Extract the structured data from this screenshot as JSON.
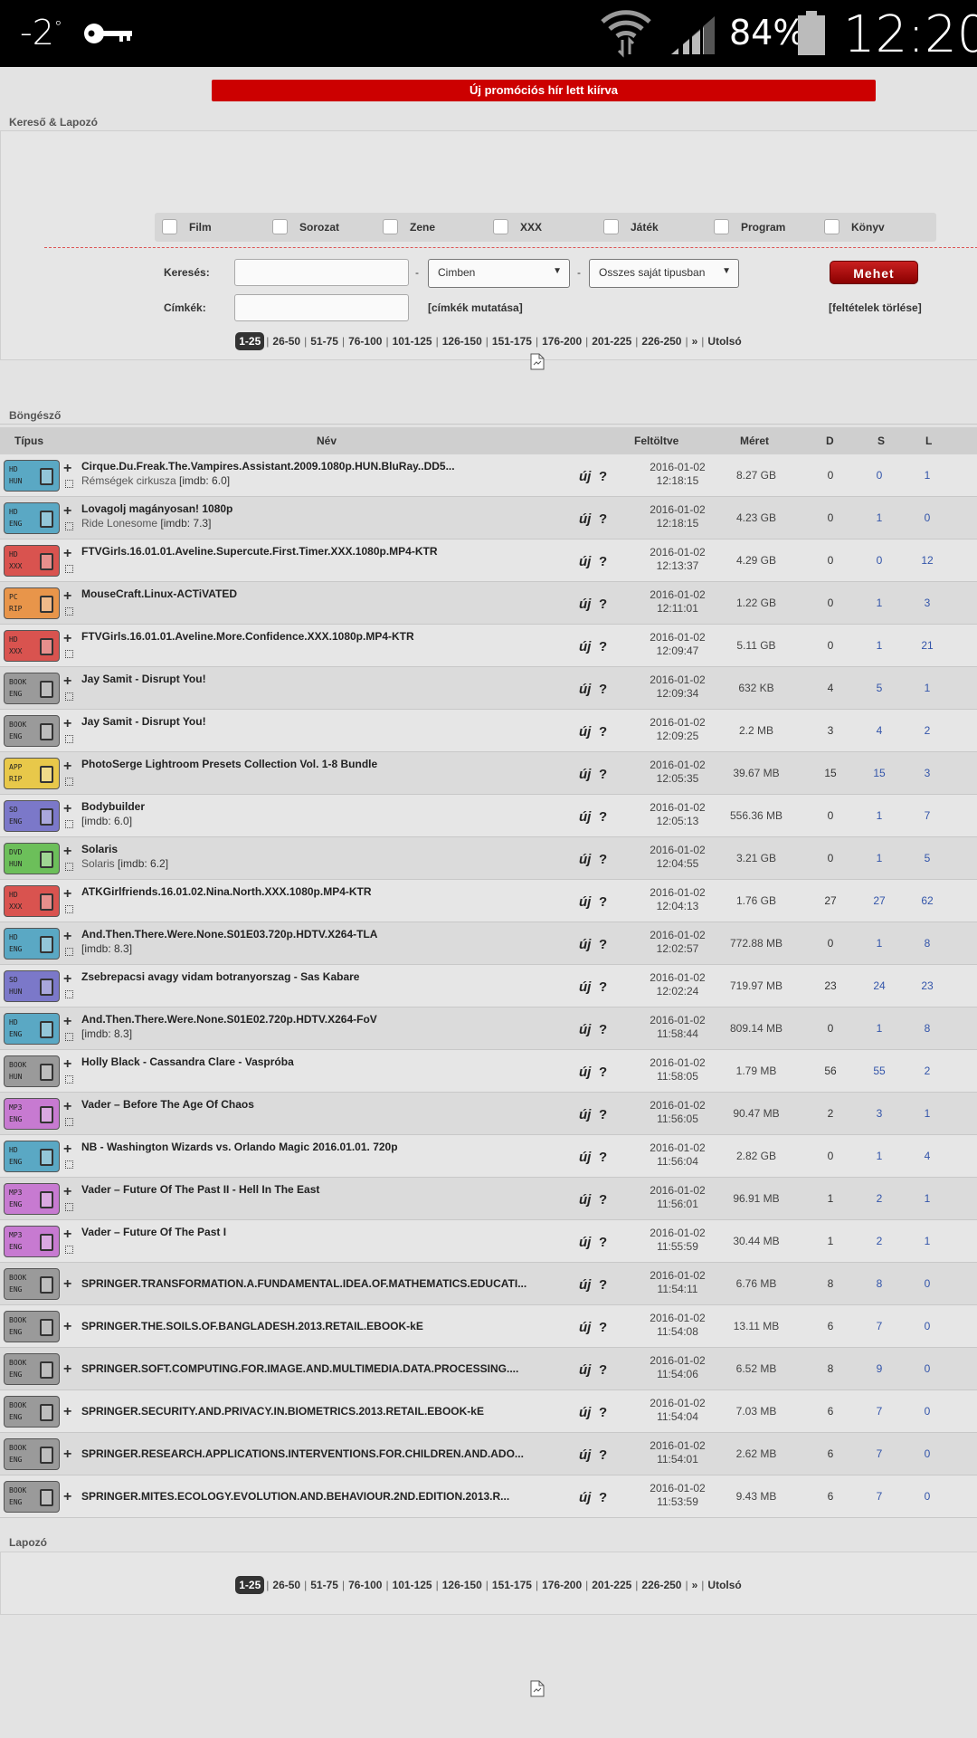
{
  "statusbar": {
    "temp": "-2",
    "deg": "°",
    "battery": "84%",
    "time": "12:20"
  },
  "promo": "Új promóciós hír lett kiírva",
  "search": {
    "title": "Kereső & Lapozó",
    "categories": [
      "Film",
      "Sorozat",
      "Zene",
      "XXX",
      "Játék",
      "Program",
      "Könyv"
    ],
    "search_label": "Keresés:",
    "tags_label": "Címkék:",
    "dash": "-",
    "scope_select": "Cimben",
    "type_select": "Osszes saját tipusban",
    "go": "Mehet",
    "show_tags": "[címkék mutatása]",
    "clear": "[feltételek törlése]"
  },
  "pager": {
    "pages": [
      "1-25",
      "26-50",
      "51-75",
      "76-100",
      "101-125",
      "126-150",
      "151-175",
      "176-200",
      "201-225",
      "226-250"
    ],
    "next": "»",
    "last": "Utolsó",
    "sep": "|"
  },
  "browser": {
    "title": "Böngésző",
    "bottom_title": "Lapozó"
  },
  "table": {
    "headers": {
      "type": "Típus",
      "name": "Név",
      "uploaded": "Feltöltve",
      "size": "Méret",
      "d": "D",
      "s": "S",
      "l": "L"
    },
    "new_label": "új",
    "q_label": "?",
    "rows": [
      {
        "badge": [
          "HD",
          "HUN"
        ],
        "color": "#5aa8c4",
        "icon": "film-icon",
        "name": "Cirque.Du.Freak.The.Vampires.Assistant.2009.1080p.HUN.BluRay..DD5...",
        "sub": "Rémségek cirkusza",
        "imdb": "[imdb: 6.0]",
        "date": "2016-01-02",
        "time": "12:18:15",
        "size": "8.27 GB",
        "d": "0",
        "s": "0",
        "l": "1"
      },
      {
        "badge": [
          "HD",
          "ENG"
        ],
        "color": "#5aa8c4",
        "icon": "film-icon",
        "name": "Lovagolj magányosan! 1080p",
        "sub": "Ride Lonesome",
        "imdb": "[imdb: 7.3]",
        "date": "2016-01-02",
        "time": "12:18:15",
        "size": "4.23 GB",
        "d": "0",
        "s": "1",
        "l": "0"
      },
      {
        "badge": [
          "HD",
          "XXX"
        ],
        "color": "#d9534f",
        "icon": "film-icon",
        "name": "FTVGirls.16.01.01.Aveline.Supercute.First.Timer.XXX.1080p.MP4-KTR",
        "sub": "",
        "imdb": "",
        "date": "2016-01-02",
        "time": "12:13:37",
        "size": "4.29 GB",
        "d": "0",
        "s": "0",
        "l": "12"
      },
      {
        "badge": [
          "PC",
          "RIP"
        ],
        "color": "#e8954a",
        "icon": "game-icon",
        "name": "MouseCraft.Linux-ACTiVATED",
        "sub": "",
        "imdb": "",
        "date": "2016-01-02",
        "time": "12:11:01",
        "size": "1.22 GB",
        "d": "0",
        "s": "1",
        "l": "3"
      },
      {
        "badge": [
          "HD",
          "XXX"
        ],
        "color": "#d9534f",
        "icon": "film-icon",
        "name": "FTVGirls.16.01.01.Aveline.More.Confidence.XXX.1080p.MP4-KTR",
        "sub": "",
        "imdb": "",
        "date": "2016-01-02",
        "time": "12:09:47",
        "size": "5.11 GB",
        "d": "0",
        "s": "1",
        "l": "21"
      },
      {
        "badge": [
          "BOOK",
          "ENG"
        ],
        "color": "#9a9a9a",
        "icon": "book-icon",
        "name": "Jay Samit - Disrupt You!",
        "sub": "",
        "imdb": "",
        "date": "2016-01-02",
        "time": "12:09:34",
        "size": "632 KB",
        "d": "4",
        "s": "5",
        "l": "1"
      },
      {
        "badge": [
          "BOOK",
          "ENG"
        ],
        "color": "#9a9a9a",
        "icon": "book-icon",
        "name": "Jay Samit - Disrupt You!",
        "sub": "",
        "imdb": "",
        "date": "2016-01-02",
        "time": "12:09:25",
        "size": "2.2 MB",
        "d": "3",
        "s": "4",
        "l": "2"
      },
      {
        "badge": [
          "APP",
          "RIP"
        ],
        "color": "#e8c84a",
        "icon": "app-icon",
        "name": "PhotoSerge Lightroom Presets Collection Vol. 1-8 Bundle",
        "sub": "",
        "imdb": "",
        "date": "2016-01-02",
        "time": "12:05:35",
        "size": "39.67 MB",
        "d": "15",
        "s": "15",
        "l": "3"
      },
      {
        "badge": [
          "SD",
          "ENG"
        ],
        "color": "#7b78c9",
        "icon": "film-icon",
        "name": "Bodybuilder",
        "sub": "",
        "imdb": "[imdb: 6.0]",
        "date": "2016-01-02",
        "time": "12:05:13",
        "size": "556.36 MB",
        "d": "0",
        "s": "1",
        "l": "7"
      },
      {
        "badge": [
          "DVD",
          "HUN"
        ],
        "color": "#6cbf5a",
        "icon": "film-icon",
        "name": "Solaris",
        "sub": "Solaris",
        "imdb": "[imdb: 6.2]",
        "date": "2016-01-02",
        "time": "12:04:55",
        "size": "3.21 GB",
        "d": "0",
        "s": "1",
        "l": "5"
      },
      {
        "badge": [
          "HD",
          "XXX"
        ],
        "color": "#d9534f",
        "icon": "film-icon",
        "name": "ATKGirlfriends.16.01.02.Nina.North.XXX.1080p.MP4-KTR",
        "sub": "",
        "imdb": "",
        "date": "2016-01-02",
        "time": "12:04:13",
        "size": "1.76 GB",
        "d": "27",
        "s": "27",
        "l": "62"
      },
      {
        "badge": [
          "HD",
          "ENG"
        ],
        "color": "#5aa8c4",
        "icon": "tv-icon",
        "name": "And.Then.There.Were.None.S01E03.720p.HDTV.X264-TLA",
        "sub": "",
        "imdb": "[imdb: 8.3]",
        "date": "2016-01-02",
        "time": "12:02:57",
        "size": "772.88 MB",
        "d": "0",
        "s": "1",
        "l": "8"
      },
      {
        "badge": [
          "SD",
          "HUN"
        ],
        "color": "#7b78c9",
        "icon": "tv-icon",
        "name": "Zsebrepacsi avagy vidam botranyorszag - Sas Kabare",
        "sub": "",
        "imdb": "",
        "date": "2016-01-02",
        "time": "12:02:24",
        "size": "719.97 MB",
        "d": "23",
        "s": "24",
        "l": "23"
      },
      {
        "badge": [
          "HD",
          "ENG"
        ],
        "color": "#5aa8c4",
        "icon": "tv-icon",
        "name": "And.Then.There.Were.None.S01E02.720p.HDTV.X264-FoV",
        "sub": "",
        "imdb": "[imdb: 8.3]",
        "date": "2016-01-02",
        "time": "11:58:44",
        "size": "809.14 MB",
        "d": "0",
        "s": "1",
        "l": "8"
      },
      {
        "badge": [
          "BOOK",
          "HUN"
        ],
        "color": "#9a9a9a",
        "icon": "book-icon",
        "name": "Holly Black - Cassandra Clare - Vaspróba",
        "sub": "",
        "imdb": "",
        "date": "2016-01-02",
        "time": "11:58:05",
        "size": "1.79 MB",
        "d": "56",
        "s": "55",
        "l": "2"
      },
      {
        "badge": [
          "MP3",
          "ENG"
        ],
        "color": "#c77ad1",
        "icon": "music-icon",
        "name": "Vader – Before The Age Of Chaos",
        "sub": "",
        "imdb": "",
        "date": "2016-01-02",
        "time": "11:56:05",
        "size": "90.47 MB",
        "d": "2",
        "s": "3",
        "l": "1"
      },
      {
        "badge": [
          "HD",
          "ENG"
        ],
        "color": "#5aa8c4",
        "icon": "tv-icon",
        "name": "NB - Washington Wizards vs. Orlando Magic 2016.01.01. 720p",
        "sub": "",
        "imdb": "",
        "date": "2016-01-02",
        "time": "11:56:04",
        "size": "2.82 GB",
        "d": "0",
        "s": "1",
        "l": "4"
      },
      {
        "badge": [
          "MP3",
          "ENG"
        ],
        "color": "#c77ad1",
        "icon": "music-icon",
        "name": "Vader – Future Of The Past II - Hell In The East",
        "sub": "",
        "imdb": "",
        "date": "2016-01-02",
        "time": "11:56:01",
        "size": "96.91 MB",
        "d": "1",
        "s": "2",
        "l": "1"
      },
      {
        "badge": [
          "MP3",
          "ENG"
        ],
        "color": "#c77ad1",
        "icon": "music-icon",
        "name": "Vader – Future Of The Past I",
        "sub": "",
        "imdb": "",
        "date": "2016-01-02",
        "time": "11:55:59",
        "size": "30.44 MB",
        "d": "1",
        "s": "2",
        "l": "1"
      },
      {
        "badge": [
          "BOOK",
          "ENG"
        ],
        "color": "#9a9a9a",
        "icon": "book-icon",
        "name": "SPRINGER.TRANSFORMATION.A.FUNDAMENTAL.IDEA.OF.MATHEMATICS.EDUCATI...",
        "sub": "",
        "imdb": "",
        "single": true,
        "date": "2016-01-02",
        "time": "11:54:11",
        "size": "6.76 MB",
        "d": "8",
        "s": "8",
        "l": "0"
      },
      {
        "badge": [
          "BOOK",
          "ENG"
        ],
        "color": "#9a9a9a",
        "icon": "book-icon",
        "name": "SPRINGER.THE.SOILS.OF.BANGLADESH.2013.RETAIL.EBOOK-kE",
        "sub": "",
        "imdb": "",
        "single": true,
        "date": "2016-01-02",
        "time": "11:54:08",
        "size": "13.11 MB",
        "d": "6",
        "s": "7",
        "l": "0"
      },
      {
        "badge": [
          "BOOK",
          "ENG"
        ],
        "color": "#9a9a9a",
        "icon": "book-icon",
        "name": "SPRINGER.SOFT.COMPUTING.FOR.IMAGE.AND.MULTIMEDIA.DATA.PROCESSING....",
        "sub": "",
        "imdb": "",
        "single": true,
        "date": "2016-01-02",
        "time": "11:54:06",
        "size": "6.52 MB",
        "d": "8",
        "s": "9",
        "l": "0"
      },
      {
        "badge": [
          "BOOK",
          "ENG"
        ],
        "color": "#9a9a9a",
        "icon": "book-icon",
        "name": "SPRINGER.SECURITY.AND.PRIVACY.IN.BIOMETRICS.2013.RETAIL.EBOOK-kE",
        "sub": "",
        "imdb": "",
        "single": true,
        "date": "2016-01-02",
        "time": "11:54:04",
        "size": "7.03 MB",
        "d": "6",
        "s": "7",
        "l": "0"
      },
      {
        "badge": [
          "BOOK",
          "ENG"
        ],
        "color": "#9a9a9a",
        "icon": "book-icon",
        "name": "SPRINGER.RESEARCH.APPLICATIONS.INTERVENTIONS.FOR.CHILDREN.AND.ADO...",
        "sub": "",
        "imdb": "",
        "single": true,
        "date": "2016-01-02",
        "time": "11:54:01",
        "size": "2.62 MB",
        "d": "6",
        "s": "7",
        "l": "0"
      },
      {
        "badge": [
          "BOOK",
          "ENG"
        ],
        "color": "#9a9a9a",
        "icon": "book-icon",
        "name": "SPRINGER.MITES.ECOLOGY.EVOLUTION.AND.BEHAVIOUR.2ND.EDITION.2013.R...",
        "sub": "",
        "imdb": "",
        "single": true,
        "date": "2016-01-02",
        "time": "11:53:59",
        "size": "9.43 MB",
        "d": "6",
        "s": "7",
        "l": "0"
      }
    ]
  }
}
